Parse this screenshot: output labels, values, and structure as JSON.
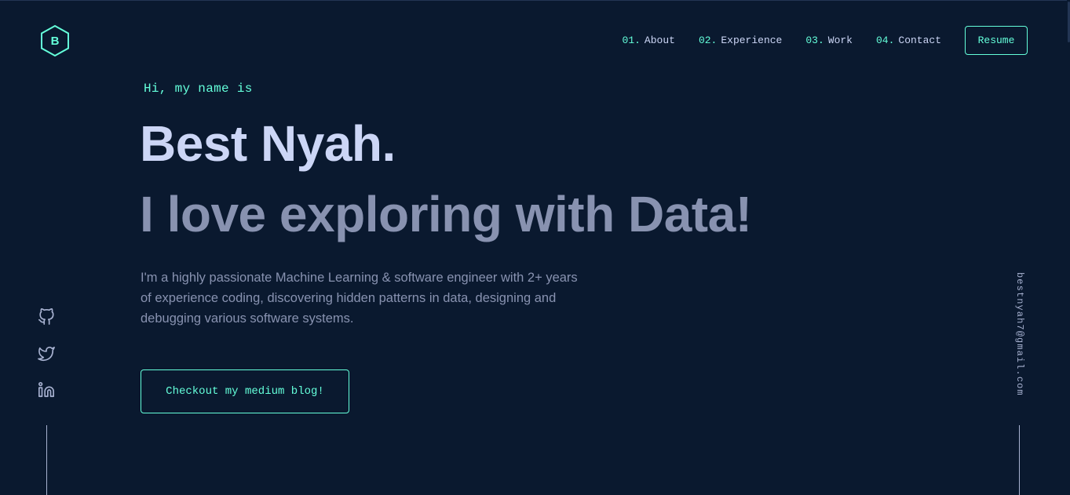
{
  "colors": {
    "background": "#0a192f",
    "accent": "#64ffda",
    "heading": "#ccd6f6",
    "text": "#8892b0"
  },
  "logo": {
    "letter": "B",
    "icon": "hexagon-logo-icon"
  },
  "nav": {
    "items": [
      {
        "number": "01.",
        "label": "About"
      },
      {
        "number": "02.",
        "label": "Experience"
      },
      {
        "number": "03.",
        "label": "Work"
      },
      {
        "number": "04.",
        "label": "Contact"
      }
    ],
    "resume_label": "Resume"
  },
  "hero": {
    "greeting": "Hi, my name is",
    "name": "Best Nyah.",
    "tagline": "I love exploring with Data!",
    "description": "I'm a highly passionate Machine Learning & software engineer with 2+ years of experience coding, discovering hidden patterns in data, designing and debugging various software systems.",
    "cta_label": "Checkout my medium blog!"
  },
  "social": {
    "icons": [
      "github-icon",
      "twitter-icon",
      "linkedin-icon"
    ]
  },
  "email": "bestnyah7@gmail.com"
}
